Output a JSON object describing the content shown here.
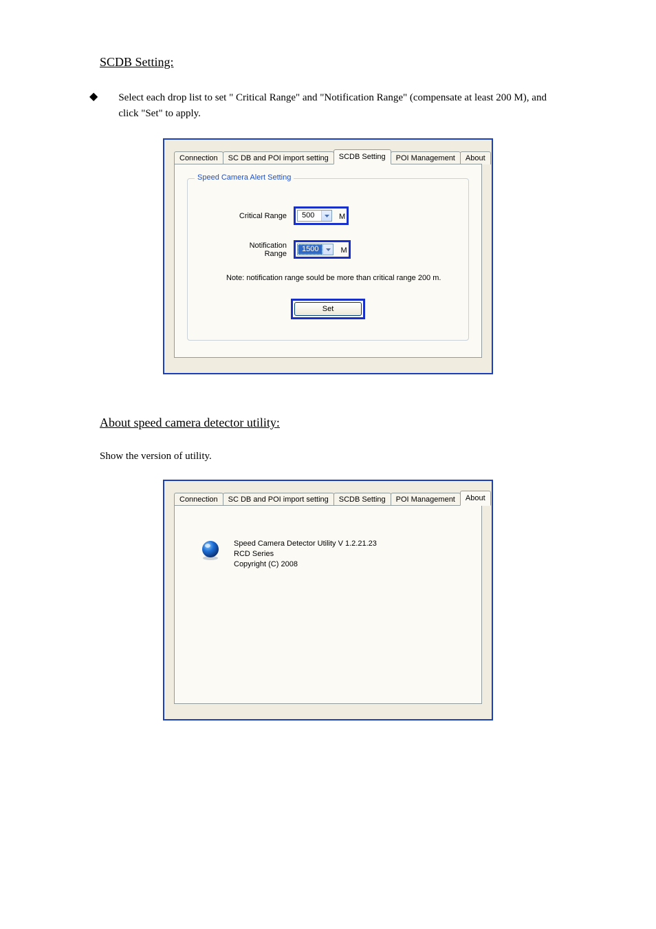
{
  "section1_title": "SCDB Setting:",
  "bullet1": "Select each drop list to set \" Critical Range\" and \"Notification Range\" (compensate at least 200 M), and click \"Set\" to apply.",
  "panel1": {
    "tabs": {
      "connection": "Connection",
      "import": "SC DB and POI import setting",
      "scdb": "SCDB  Setting",
      "poi": "POI Management",
      "about": "About"
    },
    "fieldset_legend": "Speed Camera Alert Setting",
    "critical_label": "Critical Range",
    "critical_value": "500",
    "critical_unit": "M",
    "notification_label": "Notification Range",
    "notification_value": "1500",
    "notification_unit": "M",
    "note": "Note: notification range sould be more than  critical range 200 m.",
    "set_button": "Set"
  },
  "section2_title": "About speed camera detector utility:",
  "sentence2": "Show the version of utility.",
  "panel2": {
    "tabs": {
      "connection": "Connection",
      "import": "SC DB and POI import setting",
      "scdb": "SCDB  Setting",
      "poi": "POI Management",
      "about": "About"
    },
    "line1": "Speed Camera Detector Utility  V 1.2.21.23",
    "line2": "RCD Series",
    "line3": "Copyright (C) 2008"
  }
}
